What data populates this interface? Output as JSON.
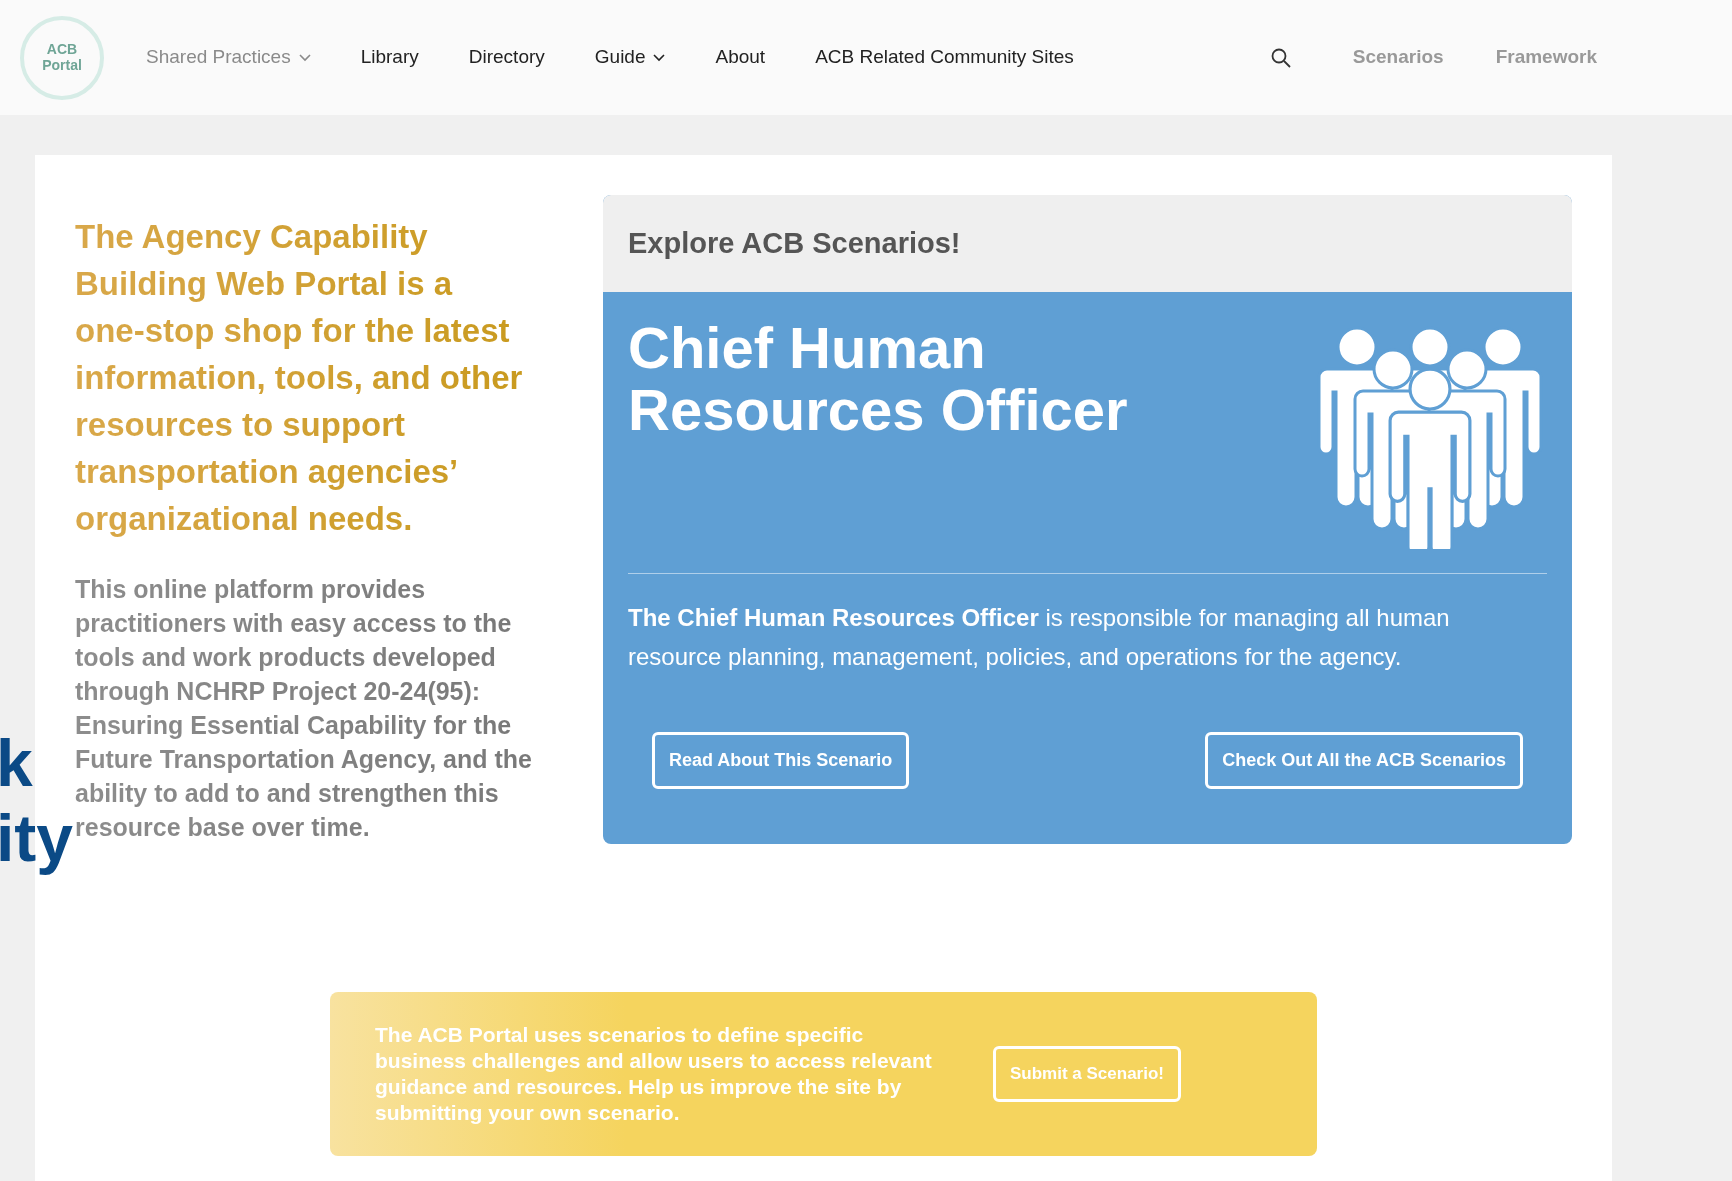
{
  "navbar": {
    "logo": {
      "line1": "ACB",
      "line2": "Portal"
    },
    "items": [
      {
        "label": "Shared Practices",
        "dropdown": true
      },
      {
        "label": "Library",
        "dropdown": false
      },
      {
        "label": "Directory",
        "dropdown": false
      },
      {
        "label": "Guide",
        "dropdown": true
      },
      {
        "label": "About",
        "dropdown": false
      },
      {
        "label": "ACB Related Community Sites",
        "dropdown": false
      }
    ],
    "right_links": [
      "Scenarios",
      "Framework"
    ]
  },
  "edge_fragments": [
    "k",
    "ity"
  ],
  "intro": {
    "heading": "The Agency Capability Building Web Portal is a one-stop shop for the latest information, tools, and other resources to support transportation agencies’ organizational needs.",
    "paragraph": "This online platform provides practitioners with easy access to the tools and work products developed through NCHRP Project 20-24(95): Ensuring Essential Capability for the Future Transportation Agency, and the ability to add to and strengthen this resource base over time."
  },
  "scenario_card": {
    "header": "Explore ACB Scenarios!",
    "title": "Chief Human Resources Officer",
    "description": "**The Chief Human Resources Officer** is responsible for managing all human resource planning, management, policies, and operations for the agency.",
    "buttons": [
      "Read About This Scenario",
      "Check Out All the ACB Scenarios"
    ]
  },
  "banner": {
    "text": "The ACB Portal uses scenarios to define specific business challenges and allow users to access relevant guidance and resources. Help us improve the site by submitting your own scenario.",
    "button": "Submit a Scenario!"
  }
}
